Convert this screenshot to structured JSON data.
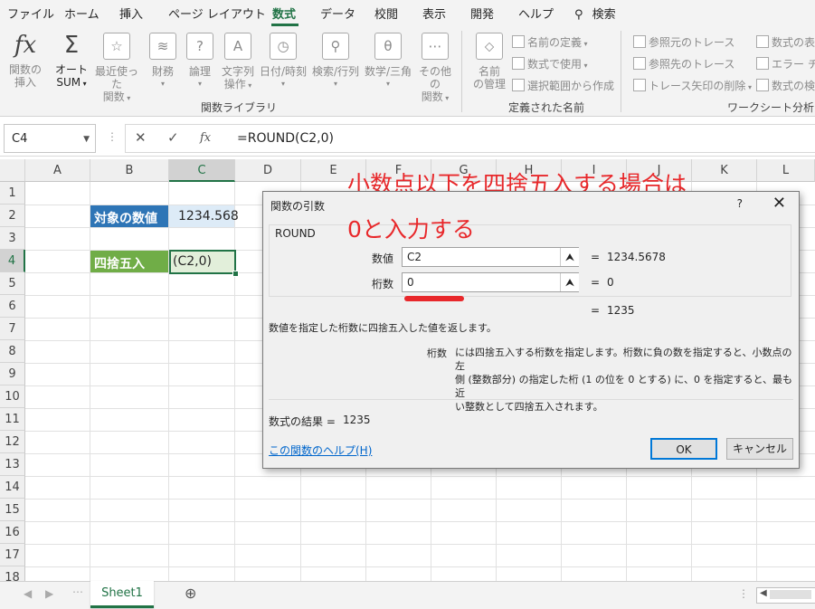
{
  "ribbon": {
    "tabs": [
      "ファイル",
      "ホーム",
      "挿入",
      "ページ レイアウト",
      "数式",
      "データ",
      "校閲",
      "表示",
      "開発",
      "ヘルプ"
    ],
    "active_tab": "数式",
    "search_label": "検索",
    "buttons": {
      "insert_function": [
        "関数の",
        "挿入"
      ],
      "autosum": [
        "オート",
        "SUM"
      ],
      "recent": [
        "最近使った",
        "関数"
      ],
      "financial": "財務",
      "logical": "論理",
      "text": [
        "文字列",
        "操作"
      ],
      "datetime": "日付/時刻",
      "lookup": "検索/行列",
      "math": "数学/三角",
      "more": [
        "その他の",
        "関数"
      ],
      "name_manager": [
        "名前",
        "の管理"
      ]
    },
    "name_cmds": [
      "名前の定義",
      "数式で使用",
      "選択範囲から作成"
    ],
    "audit_cmds": [
      "参照元のトレース",
      "参照先のトレース",
      "トレース矢印の削除"
    ],
    "audit_cmds2": [
      "数式の表",
      "エラー チェ",
      "数式の検"
    ],
    "group_labels": [
      "関数ライブラリ",
      "定義された名前",
      "ワークシート分析"
    ]
  },
  "formula_bar": {
    "name_box": "C4",
    "cancel_icon": "✕",
    "enter_icon": "✓",
    "fx_label": "fx",
    "formula": "=ROUND(C2,0)"
  },
  "grid": {
    "columns": [
      "A",
      "B",
      "C",
      "D",
      "E",
      "F",
      "G",
      "H",
      "I",
      "J",
      "K",
      "L"
    ],
    "rows": [
      "1",
      "2",
      "3",
      "4",
      "5",
      "6",
      "7",
      "8",
      "9",
      "10",
      "11",
      "12",
      "13",
      "14",
      "15",
      "16",
      "17",
      "18"
    ],
    "selected_cell": "C4",
    "cells": {
      "b2": "対象の数値",
      "c2": "1234.568",
      "b4": "四捨五入",
      "c4": "(C2,0)"
    },
    "colors": {
      "b2_fill": "#2e75b6",
      "c2_fill": "#ddebf7",
      "b4_fill": "#70ad47",
      "c4_fill": "#e2efda"
    }
  },
  "annotation": {
    "line1": "小数点以下を四捨五入する場合は",
    "line2": "0と入力する",
    "color": "#e8282b"
  },
  "dialog": {
    "title": "関数の引数",
    "help_button": "?",
    "close_button": "✕",
    "function_name": "ROUND",
    "args": [
      {
        "label": "数値",
        "value": "C2",
        "result": "1234.5678"
      },
      {
        "label": "桁数",
        "value": "0",
        "result": "0"
      }
    ],
    "collapse_icon": "⮝",
    "equals": "=",
    "overall_result": "1235",
    "description": "数値を指定した桁数に四捨五入した値を返します。",
    "arg_help_label": "桁数",
    "arg_help_lines": [
      "には四捨五入する桁数を指定します。桁数に負の数を指定すると、小数点の左",
      "側 (整数部分) の指定した桁 (1 の位を 0 とする) に、0 を指定すると、最も近",
      "い整数として四捨五入されます。"
    ],
    "formula_result_label": "数式の結果 =",
    "formula_result": "1235",
    "help_link": "この関数のヘルプ(H)",
    "ok": "OK",
    "cancel": "キャンセル"
  },
  "sheets": {
    "tabs": [
      "Sheet1"
    ],
    "add_icon": "⊕"
  }
}
